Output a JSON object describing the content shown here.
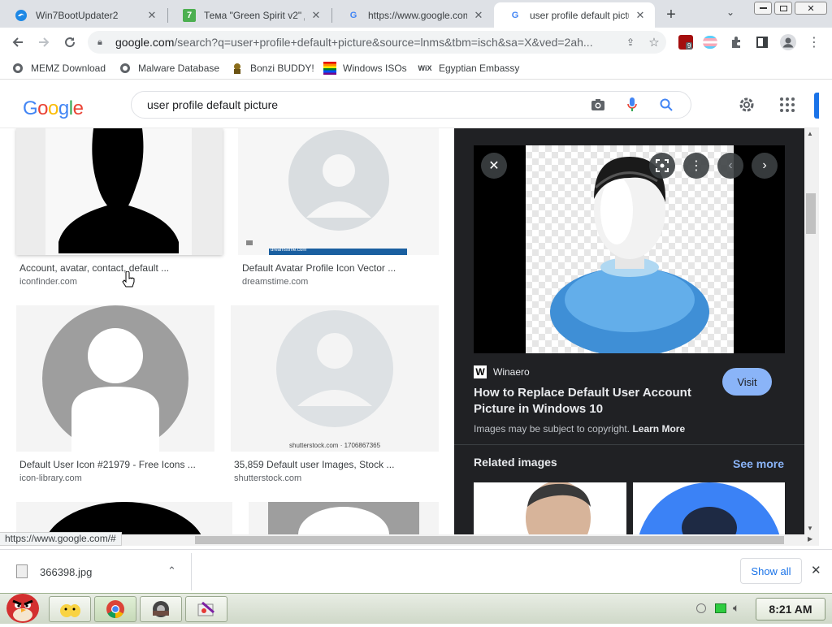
{
  "browser": {
    "tabs": [
      {
        "label": "Win7BootUpdater2",
        "icon": "edge-icon"
      },
      {
        "label": "Тема \"Green Spirit v2\" дл",
        "icon": "ucoz-icon"
      },
      {
        "label": "https://www.google.com/",
        "icon": "google-icon"
      },
      {
        "label": "user profile default pictur",
        "icon": "google-icon",
        "active": true
      }
    ],
    "new_tab": "+",
    "url_domain": "google.com",
    "url_rest": "/search?q=user+profile+default+picture&source=lnms&tbm=isch&sa=X&ved=2ah...",
    "extension_badge": "9",
    "bookmarks": [
      {
        "label": "MEMZ Download"
      },
      {
        "label": "Malware Database"
      },
      {
        "label": "Bonzi BUDDY!"
      },
      {
        "label": "Windows ISOs"
      },
      {
        "label": "Egyptian Embassy"
      }
    ]
  },
  "google": {
    "logo": "Google",
    "query": "user profile default picture"
  },
  "results": [
    {
      "title": "Account, avatar, contact, default ...",
      "site": "iconfinder.com"
    },
    {
      "title": "Default Avatar Profile Icon Vector ...",
      "site": "dreamstime.com",
      "watermark": "dreamstime.com"
    },
    {
      "title": "Default User Icon #21979 - Free Icons ...",
      "site": "icon-library.com"
    },
    {
      "title": "35,859 Default user Images, Stock ...",
      "site": "shutterstock.com",
      "watermark": "shutterstock.com · 1706867365"
    }
  ],
  "preview": {
    "source": "Winaero",
    "source_logo": "W",
    "title_line1": "How to Replace Default User Account",
    "title_line2": "Picture in Windows 10",
    "visit": "Visit",
    "copyright": "Images may be subject to copyright.",
    "learn_more": "Learn More",
    "related": "Related images",
    "see_more": "See more"
  },
  "status_url": "https://www.google.com/#",
  "download": {
    "filename": "366398.jpg",
    "show_all": "Show all"
  },
  "taskbar": {
    "time": "8:21 AM"
  },
  "colors": {
    "accent_blue": "#1a73e8",
    "visit_button": "#8ab4f8",
    "panel_bg": "#202124"
  }
}
